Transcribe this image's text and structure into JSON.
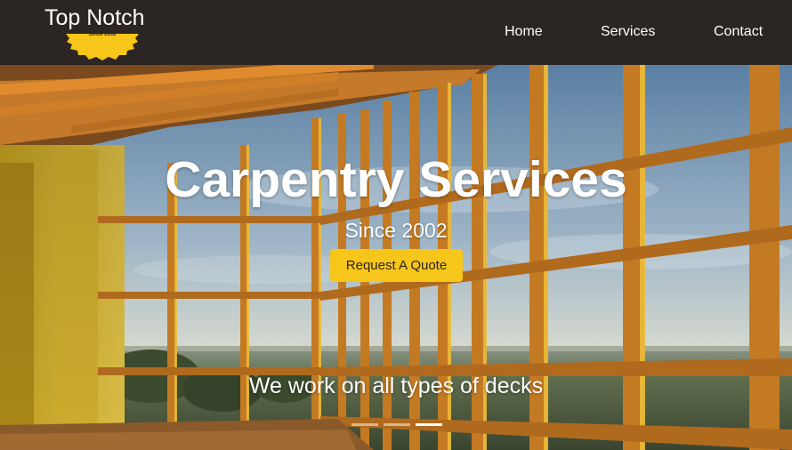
{
  "navbar": {
    "brand": {
      "name": "Top Notch",
      "since": "Since 2002",
      "logo_icon": "saw-blade-icon"
    },
    "links": [
      {
        "label": "Home"
      },
      {
        "label": "Services"
      },
      {
        "label": "Contact"
      }
    ]
  },
  "hero": {
    "title": "Carpentry Services",
    "subtitle": "Since 2002",
    "cta_label": "Request A Quote",
    "caption": "We work on all types of decks",
    "slides": {
      "count": 3,
      "active_index": 3
    }
  },
  "colors": {
    "navbar_bg": "#2b2523",
    "accent": "#f7c61a",
    "text_light": "#ffffff"
  }
}
